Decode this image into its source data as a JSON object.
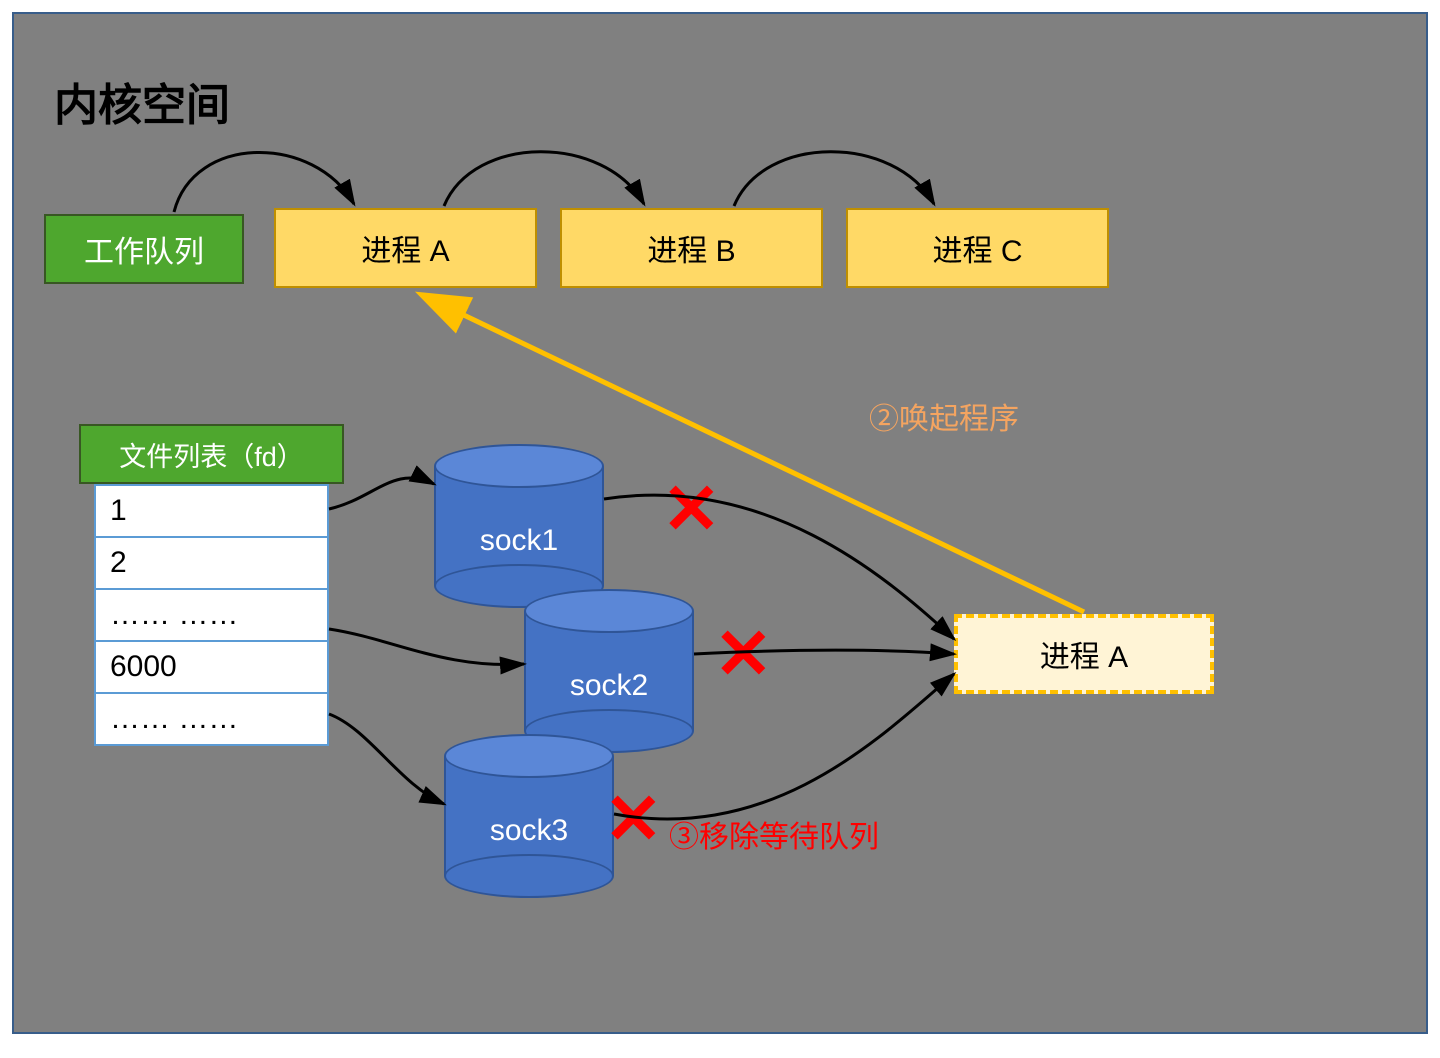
{
  "title": "内核空间",
  "workQueue": {
    "label": "工作队列"
  },
  "processes": {
    "a": "进程 A",
    "b": "进程 B",
    "c": "进程 C"
  },
  "fdTable": {
    "header": "文件列表（fd）",
    "rows": [
      "1",
      "2",
      "…… ……",
      "6000",
      "…… ……"
    ]
  },
  "sockets": {
    "s1": "sock1",
    "s2": "sock2",
    "s3": "sock3"
  },
  "movedProcess": "进程 A",
  "annotations": {
    "wake": "②唤起程序",
    "remove": "③移除等待队列"
  },
  "colors": {
    "green": "#4ea72e",
    "yellow": "#ffd966",
    "cream": "#fff4d6",
    "blue": "#4472c4",
    "red": "#ff0000",
    "arrowOrange": "#ffc000",
    "gray": "#808080"
  }
}
